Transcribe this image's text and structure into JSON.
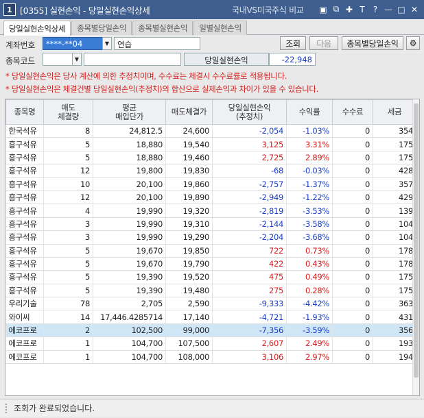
{
  "window": {
    "screen_no": "1",
    "title": "[0355] 실현손익 - 당일실현손익상세",
    "compare_label": "국내VS미국주식 비교",
    "icons": [
      "window-icon",
      "copy-icon",
      "pin-icon",
      "font-icon",
      "help-icon",
      "minimize-icon",
      "maximize-icon",
      "close-icon"
    ],
    "icon_glyphs": [
      "▣",
      "⧉",
      "✚",
      "T",
      "?",
      "—",
      "□",
      "✕"
    ]
  },
  "tabs": [
    "당일실현손익상세",
    "종목별당일손익",
    "종목별실현손익",
    "일별실현손익"
  ],
  "form": {
    "account_label": "계좌번호",
    "account_value": "****-**04",
    "account_name": "연습",
    "stock_code_label": "종목코드",
    "stock_code_value": "",
    "stock_name_value": "",
    "pnl_label": "당일실현손익",
    "pnl_value": "-22,948",
    "query_button": "조회",
    "next_button": "다음",
    "by_stock_button": "종목별당일손익"
  },
  "notices": [
    "* 당일실현손익은 당사 계산에 의한 추정치이며, 수수료는 체결시 수수료률로 적용됩니다.",
    "* 당일실현손익은 체결건별 당일실현손익(추정치)의 합산으로 실제손익과 차이가 있을 수 있습니다."
  ],
  "table": {
    "headers": [
      [
        "종목명"
      ],
      [
        "매도",
        "체결량"
      ],
      [
        "평균",
        "매입단가"
      ],
      [
        "매도체결가"
      ],
      [
        "당일실현손익",
        "(추정치)"
      ],
      [
        "수익률"
      ],
      [
        "수수료"
      ],
      [
        "세금"
      ]
    ],
    "rows": [
      [
        "한국석유",
        "8",
        "24,812.5",
        "24,600",
        "-2,054",
        "-1.03%",
        "0",
        "354"
      ],
      [
        "흥구석유",
        "5",
        "18,880",
        "19,540",
        "3,125",
        "3.31%",
        "0",
        "175"
      ],
      [
        "흥구석유",
        "5",
        "18,880",
        "19,460",
        "2,725",
        "2.89%",
        "0",
        "175"
      ],
      [
        "흥구석유",
        "12",
        "19,800",
        "19,830",
        "-68",
        "-0.03%",
        "0",
        "428"
      ],
      [
        "흥구석유",
        "10",
        "20,100",
        "19,860",
        "-2,757",
        "-1.37%",
        "0",
        "357"
      ],
      [
        "흥구석유",
        "12",
        "20,100",
        "19,890",
        "-2,949",
        "-1.22%",
        "0",
        "429"
      ],
      [
        "흥구석유",
        "4",
        "19,990",
        "19,320",
        "-2,819",
        "-3.53%",
        "0",
        "139"
      ],
      [
        "흥구석유",
        "3",
        "19,990",
        "19,310",
        "-2,144",
        "-3.58%",
        "0",
        "104"
      ],
      [
        "흥구석유",
        "3",
        "19,990",
        "19,290",
        "-2,204",
        "-3.68%",
        "0",
        "104"
      ],
      [
        "흥구석유",
        "5",
        "19,670",
        "19,850",
        "722",
        "0.73%",
        "0",
        "178"
      ],
      [
        "흥구석유",
        "5",
        "19,670",
        "19,790",
        "422",
        "0.43%",
        "0",
        "178"
      ],
      [
        "흥구석유",
        "5",
        "19,390",
        "19,520",
        "475",
        "0.49%",
        "0",
        "175"
      ],
      [
        "흥구석유",
        "5",
        "19,390",
        "19,480",
        "275",
        "0.28%",
        "0",
        "175"
      ],
      [
        "우리기술",
        "78",
        "2,705",
        "2,590",
        "-9,333",
        "-4.42%",
        "0",
        "363"
      ],
      [
        "와이씨",
        "14",
        "17,446.4285714",
        "17,140",
        "-4,721",
        "-1.93%",
        "0",
        "431"
      ],
      [
        "에코프로",
        "2",
        "102,500",
        "99,000",
        "-7,356",
        "-3.59%",
        "0",
        "356"
      ],
      [
        "에코프로",
        "1",
        "104,700",
        "107,500",
        "2,607",
        "2.49%",
        "0",
        "193"
      ],
      [
        "에코프로",
        "1",
        "104,700",
        "108,000",
        "3,106",
        "2.97%",
        "0",
        "194"
      ]
    ],
    "selected_row": 15
  },
  "status": {
    "message": "조회가 완료되었습니다."
  },
  "colors": {
    "titlebar": "#3d5e8e",
    "positive": "#d51b1b",
    "negative": "#1a3fc4",
    "notice": "#d02020",
    "selected_row": "#cfe6f6"
  }
}
